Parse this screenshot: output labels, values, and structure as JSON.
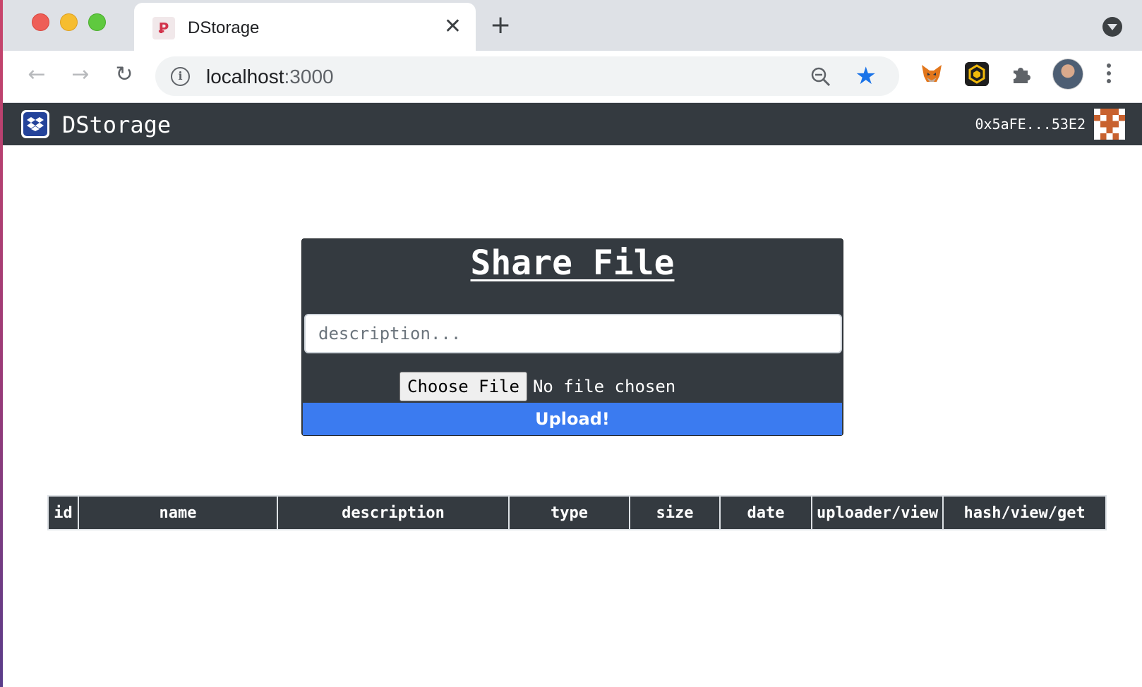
{
  "browser": {
    "tab_title": "DStorage",
    "tab_close": "✕",
    "new_tab": "+",
    "url_host": "localhost",
    "url_port": ":3000",
    "favicon_letter": "Ꝑ"
  },
  "app": {
    "brand": "DStorage",
    "account": "0x5aFE...53E2"
  },
  "share": {
    "title": "Share File",
    "description_placeholder": "description...",
    "choose_file_label": "Choose File",
    "file_status": "No file chosen",
    "upload_label": "Upload!"
  },
  "table": {
    "columns": [
      "id",
      "name",
      "description",
      "type",
      "size",
      "date",
      "uploader/view",
      "hash/view/get"
    ],
    "rows": []
  },
  "colors": {
    "navbar": "#343a40",
    "upload_button": "#3b7bf0",
    "star": "#1a73e8"
  }
}
